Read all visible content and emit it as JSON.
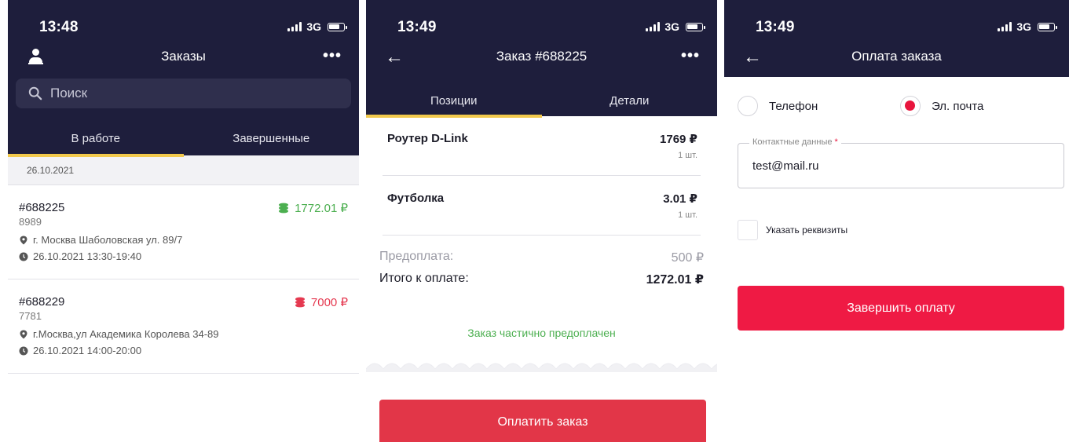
{
  "colors": {
    "header_bg": "#1e1e3c",
    "accent_tab": "#f2c94c",
    "paid_green": "#4caf50",
    "unpaid_red": "#e53950",
    "pay_button": "#e23648",
    "finish_button": "#ef1a44"
  },
  "screen1": {
    "status": {
      "time": "13:48",
      "network": "3G"
    },
    "title": "Заказы",
    "search_placeholder": "Поиск",
    "tabs": [
      "В работе",
      "Завершенные"
    ],
    "date": "26.10.2021",
    "orders": [
      {
        "number": "#688225",
        "code": "8989",
        "sum": "1772.01 ₽",
        "address": "г. Москва Шаболовская ул. 89/7",
        "time": "26.10.2021 13:30-19:40",
        "status_color": "green"
      },
      {
        "number": "#688229",
        "code": "7781",
        "sum": "7000 ₽",
        "address": "г.Москва,ул Академика Королева 34-89",
        "time": "26.10.2021 14:00-20:00",
        "status_color": "red"
      }
    ]
  },
  "screen2": {
    "status": {
      "time": "13:49",
      "network": "3G"
    },
    "title": "Заказ #688225",
    "tabs": [
      "Позиции",
      "Детали"
    ],
    "items": [
      {
        "name": "Роутер D-Link",
        "price": "1769 ₽",
        "qty": "1 шт."
      },
      {
        "name": "Футболка",
        "price": "3.01 ₽",
        "qty": "1 шт."
      }
    ],
    "prepay_label": "Предоплата:",
    "prepay_value": "500 ₽",
    "total_label": "Итого к оплате:",
    "total_value": "1272.01 ₽",
    "partial_note": "Заказ частично предоплачен",
    "pay_button": "Оплатить заказ"
  },
  "screen3": {
    "status": {
      "time": "13:49",
      "network": "3G"
    },
    "title": "Оплата заказа",
    "radio_phone": "Телефон",
    "radio_email": "Эл. почта",
    "field_label": "Контактные данные",
    "field_required": "*",
    "field_value": "test@mail.ru",
    "checkbox_label": "Указать реквизиты",
    "finish_button": "Завершить оплату"
  }
}
